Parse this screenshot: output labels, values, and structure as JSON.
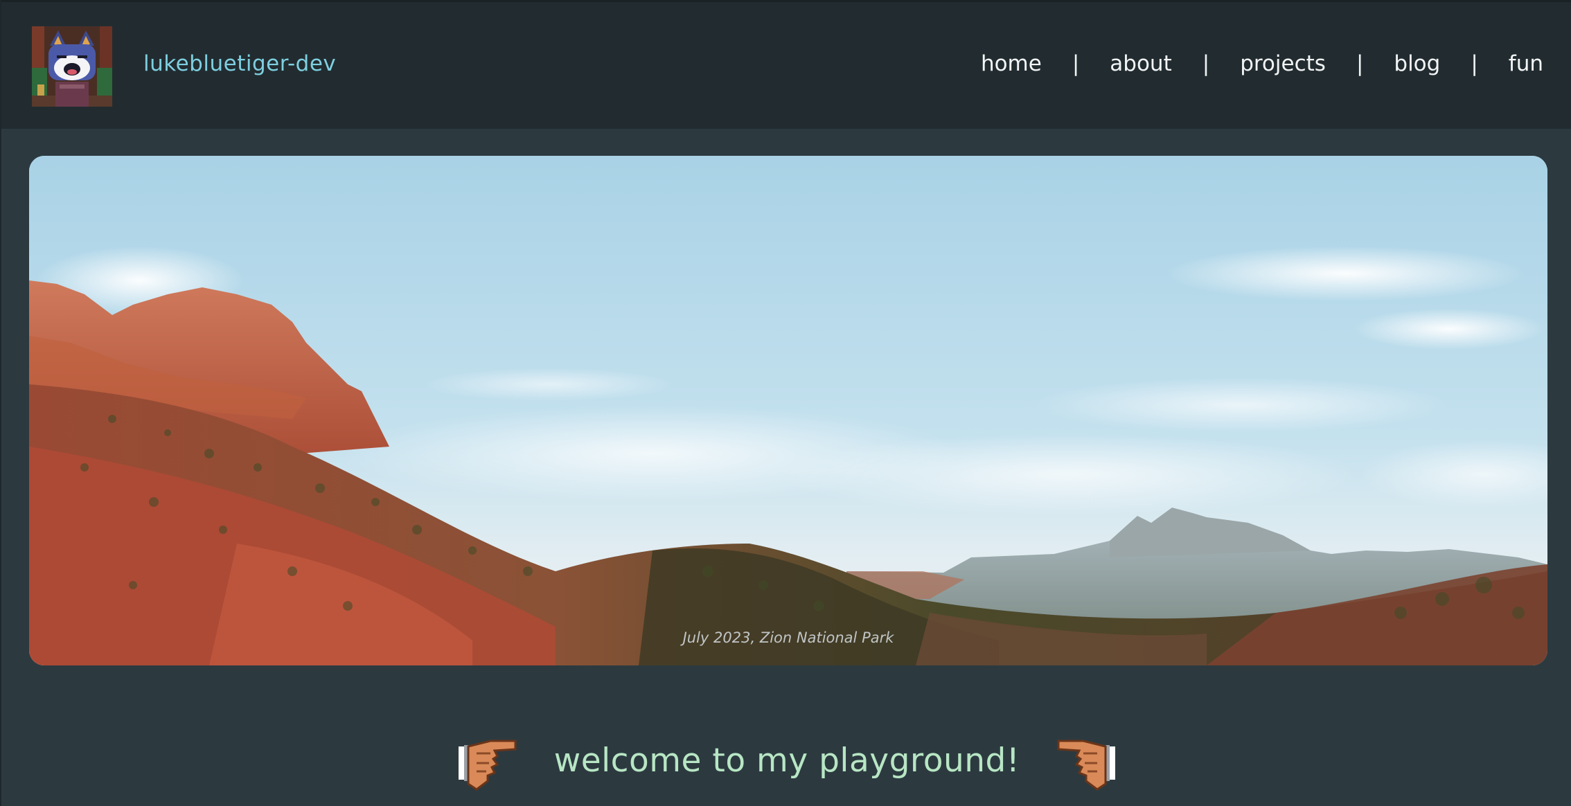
{
  "header": {
    "site_title": "lukebluetiger-dev",
    "avatar_icon": "cat-avatar-icon",
    "nav": [
      {
        "label": "home"
      },
      {
        "label": "about"
      },
      {
        "label": "projects"
      },
      {
        "label": "blog"
      },
      {
        "label": "fun"
      }
    ],
    "nav_separator": "|"
  },
  "hero": {
    "caption": "July 2023, Zion National Park"
  },
  "welcome": {
    "text": "welcome to my playground!",
    "left_icon": "pointing-hand-right-icon",
    "right_icon": "pointing-hand-left-icon"
  },
  "colors": {
    "header_bg": "#222c30",
    "page_bg": "#2c3a40",
    "title_color": "#7ecfe0",
    "welcome_color": "#b8e6c4"
  }
}
